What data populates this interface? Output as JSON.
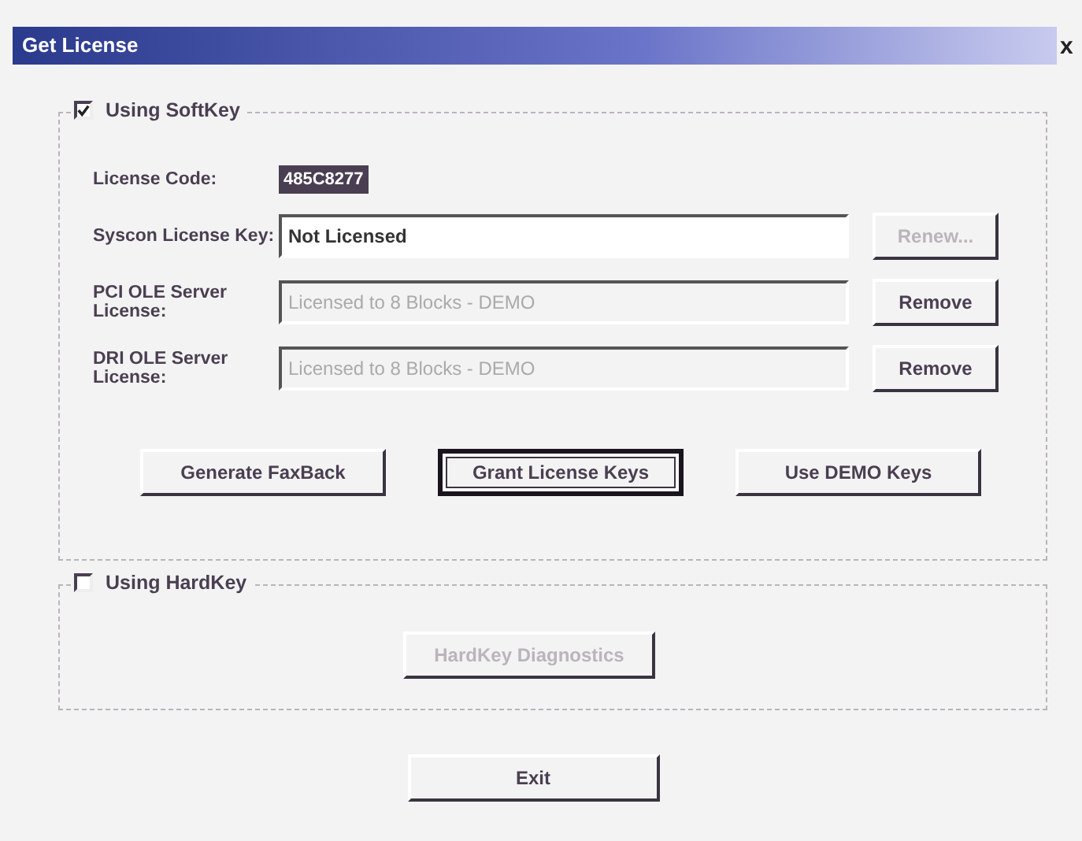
{
  "window": {
    "title": "Get License",
    "close": "x"
  },
  "softkey": {
    "label": "Using SoftKey",
    "checked": true,
    "license_code": {
      "label": "License Code:",
      "value": "485C8277"
    },
    "rows": [
      {
        "label": "Syscon License Key:",
        "value": "Not Licensed",
        "disabled": false,
        "button": "Renew...",
        "button_disabled": true
      },
      {
        "label": "PCI OLE Server License:",
        "value": "Licensed to 8 Blocks - DEMO",
        "disabled": true,
        "button": "Remove",
        "button_disabled": false
      },
      {
        "label": "DRI OLE Server License:",
        "value": "Licensed to 8 Blocks - DEMO",
        "disabled": true,
        "button": "Remove",
        "button_disabled": false
      }
    ],
    "buttons": [
      {
        "label": "Generate FaxBack",
        "focused": false
      },
      {
        "label": "Grant License Keys",
        "focused": true
      },
      {
        "label": "Use DEMO Keys",
        "focused": false
      }
    ]
  },
  "hardkey": {
    "label": "Using HardKey",
    "checked": false,
    "button": {
      "label": "HardKey Diagnostics",
      "disabled": true
    }
  },
  "exit": "Exit"
}
